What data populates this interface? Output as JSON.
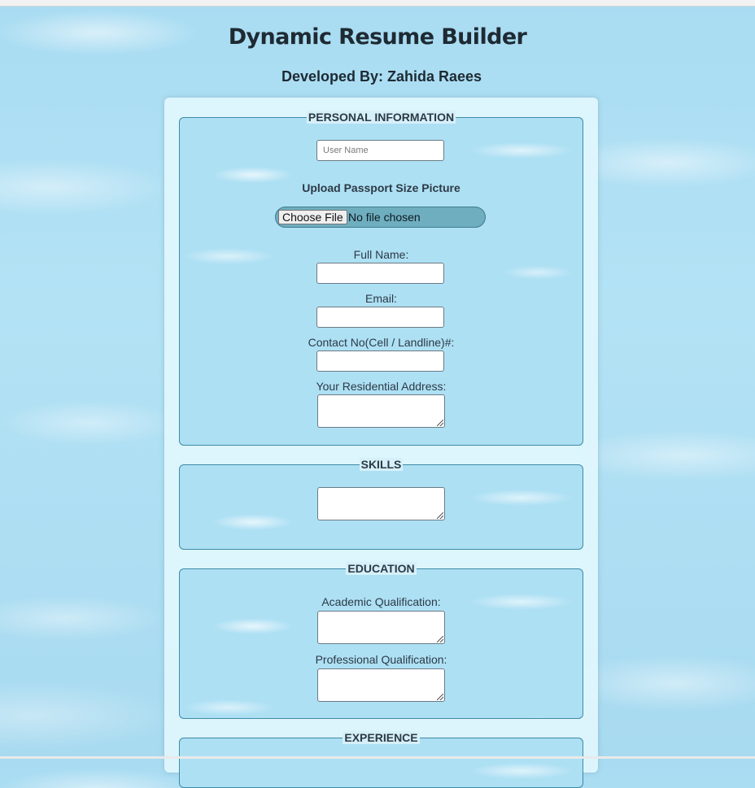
{
  "header": {
    "title": "Dynamic Resume Builder",
    "subtitle": "Developed By: Zahida Raees"
  },
  "personal": {
    "legend": "PERSONAL INFORMATION",
    "username_placeholder": "User Name",
    "upload_label": "Upload Passport Size Picture",
    "file_button": "Choose File",
    "file_status": "No file chosen",
    "full_name_label": "Full Name:",
    "email_label": "Email:",
    "contact_label": "Contact No(Cell / Landline)#:",
    "address_label": "Your Residential Address:"
  },
  "skills": {
    "legend": "SKILLS"
  },
  "education": {
    "legend": "EDUCATION",
    "academic_label": "Academic Qualification:",
    "professional_label": "Professional Qualification:"
  },
  "experience": {
    "legend": "EXPERIENCE"
  }
}
